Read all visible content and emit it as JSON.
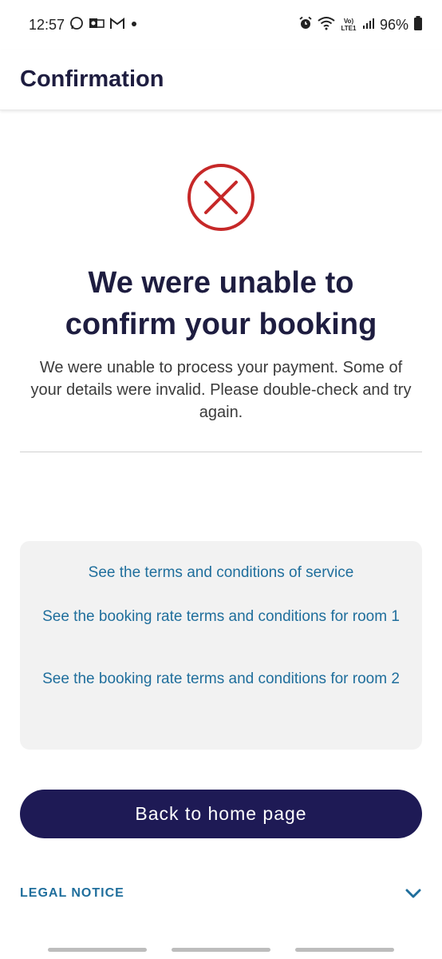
{
  "status_bar": {
    "time": "12:57",
    "left_icons": [
      "whatsapp-icon",
      "outlook-icon",
      "gmail-icon",
      "dot-icon"
    ],
    "right_icons": [
      "alarm-icon",
      "wifi-icon",
      "volte-icon",
      "signal-icon",
      "battery-icon"
    ],
    "volte_label": "Vo) LTE1",
    "battery": "96%"
  },
  "appbar": {
    "title": "Confirmation"
  },
  "result": {
    "icon": "error-x-circle-icon",
    "icon_color": "#c62828",
    "headline": "We were unable to confirm your booking",
    "message": "We were unable to process your payment. Some of your details were invalid. Please double-check and try again."
  },
  "terms": {
    "links": [
      "See the terms and conditions of service",
      "See the booking rate terms and conditions for room 1",
      "See the booking rate terms and conditions for room 2"
    ]
  },
  "actions": {
    "back_home_label": "Back to home page"
  },
  "legal": {
    "label": "LEGAL NOTICE",
    "icon": "chevron-down-icon"
  },
  "colors": {
    "primary_navy": "#1e1a55",
    "link_blue": "#1f6e9c",
    "error_red": "#c62828",
    "panel_grey": "#f2f2f2"
  }
}
